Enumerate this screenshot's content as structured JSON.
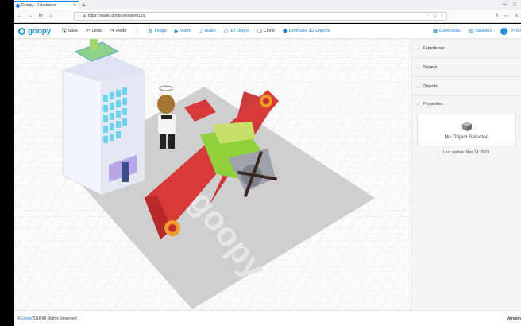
{
  "browser": {
    "tab_title": "Goopy - Experience",
    "tab_close": "×",
    "new_tab": "+",
    "url": "https://studio.goopy.io/editor/119",
    "url_actions": [
      "···",
      "⛉",
      "☆"
    ]
  },
  "toolbar": {
    "logo": "goopy",
    "save": "Save",
    "undo": "Undo",
    "redo": "Redo",
    "more": "⋮",
    "image": "Image",
    "video": "Video",
    "audio": "Audio",
    "object3d": "3D Object",
    "clone": "Clone",
    "unrender": "Unrender 3D Objects",
    "collections": "Collections",
    "statistics": "Statistics",
    "pro": "PRO"
  },
  "panel": {
    "sections": [
      "Experience",
      "Targets",
      "Objects",
      "Properties"
    ],
    "no_object": "No Object Selected",
    "last_update": "Last update:  Mar 18, 2019"
  },
  "scene": {
    "ground_text": "goopy"
  },
  "footer": {
    "copyright_prefix": "©",
    "brand": "Goopy",
    "rights": " 2018 All Rights Reserved.",
    "version": "Version"
  },
  "colors": {
    "accent": "#1f8fd6",
    "plane_wing": "#d63a3a",
    "plane_body": "#8fd13a"
  }
}
